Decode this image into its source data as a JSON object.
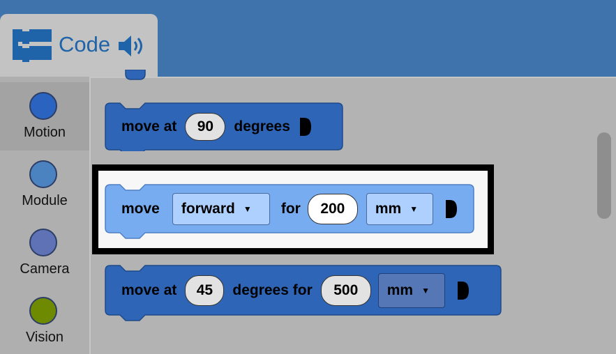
{
  "tab": {
    "label": "Code",
    "icon": "blocks-icon",
    "audio_icon": "speaker-icon"
  },
  "sidebar": {
    "items": [
      {
        "label": "Motion",
        "color": "#2a64c0",
        "selected": true
      },
      {
        "label": "Module",
        "color": "#4b82c0",
        "selected": false
      },
      {
        "label": "Camera",
        "color": "#5f72b6",
        "selected": false
      },
      {
        "label": "Vision",
        "color": "#6e8a00",
        "selected": false
      }
    ]
  },
  "blocks": {
    "move_at_degrees": {
      "kw1": "move at",
      "angle": "90",
      "kw2": "degrees"
    },
    "move_direction": {
      "kw1": "move",
      "direction": "forward",
      "kw2": "for",
      "distance": "200",
      "unit": "mm"
    },
    "move_at_degrees_for": {
      "kw1": "move at",
      "angle": "45",
      "kw2": "degrees for",
      "distance": "500",
      "unit": "mm"
    }
  },
  "colors": {
    "header_bg": "#3e73ab",
    "block_dark": "#2e65b6",
    "block_light": "#78acf0",
    "accent_text": "#1f63a8"
  }
}
